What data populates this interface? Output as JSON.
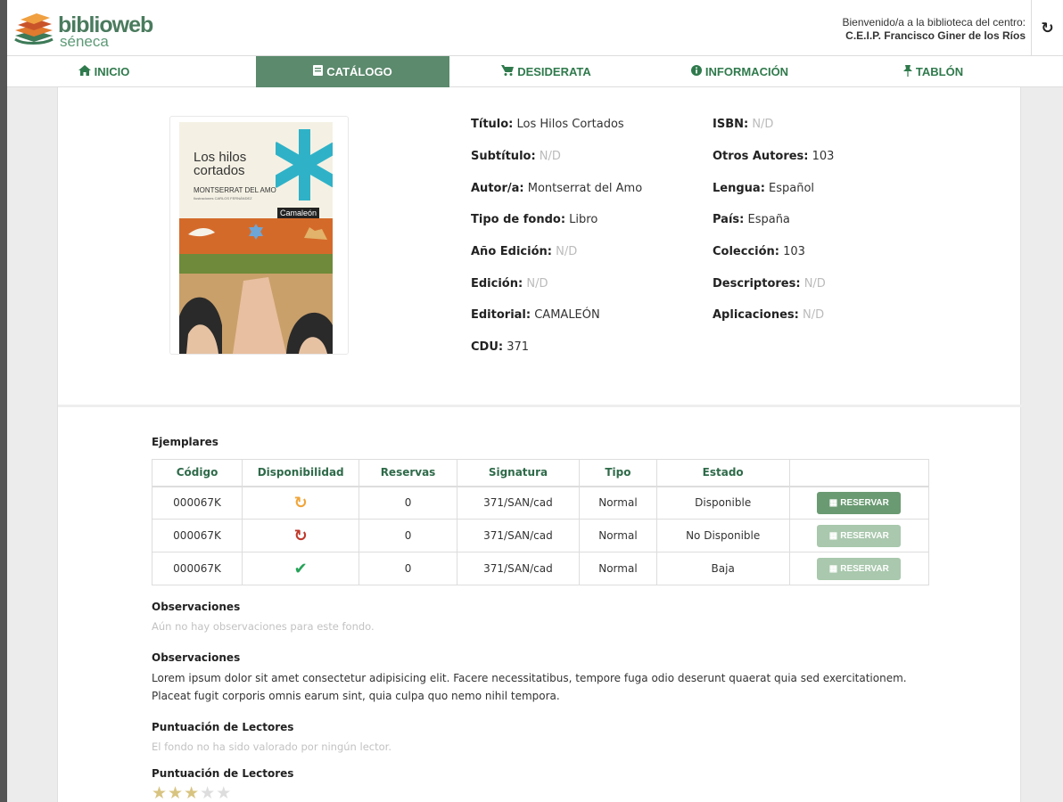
{
  "header": {
    "logo_main": "biblioweb",
    "logo_sub": "séneca",
    "welcome_line": "Bienvenido/a a la biblioteca del centro:",
    "school_name": "C.E.I.P. Francisco Giner de los Ríos",
    "refresh_icon": "refresh-icon"
  },
  "nav": {
    "items": [
      {
        "label": "INICIO",
        "icon": "home-icon",
        "active": false
      },
      {
        "label": "CATÁLOGO",
        "icon": "book-icon",
        "active": true
      },
      {
        "label": "DESIDERATA",
        "icon": "cart-icon",
        "active": false
      },
      {
        "label": "INFORMACIÓN",
        "icon": "info-icon",
        "active": false
      },
      {
        "label": "TABLÓN",
        "icon": "pin-icon",
        "active": false
      }
    ]
  },
  "cover": {
    "title": "Los hilos cortados",
    "author": "MONTSERRAT DEL AMO",
    "illustrator": "Ilustraciones CARLOS FERNÁNDEZ",
    "brand": "Camaleón"
  },
  "details": {
    "left": [
      {
        "label": "Título:",
        "value": "Los Hilos Cortados",
        "na": false
      },
      {
        "label": "Subtítulo:",
        "value": "N/D",
        "na": true
      },
      {
        "label": "Autor/a:",
        "value": "Montserrat del Amo",
        "na": false
      },
      {
        "label": "Tipo de fondo:",
        "value": "Libro",
        "na": false
      },
      {
        "label": "Año Edición:",
        "value": "N/D",
        "na": true
      },
      {
        "label": "Edición:",
        "value": "N/D",
        "na": true
      },
      {
        "label": "Editorial:",
        "value": "CAMALEÓN",
        "na": false
      },
      {
        "label": "CDU:",
        "value": "371",
        "na": false
      }
    ],
    "right": [
      {
        "label": "ISBN:",
        "value": "N/D",
        "na": true
      },
      {
        "label": "Otros Autores:",
        "value": "103",
        "na": false
      },
      {
        "label": "Lengua:",
        "value": "Español",
        "na": false
      },
      {
        "label": "País:",
        "value": "España",
        "na": false
      },
      {
        "label": "Colección:",
        "value": "103",
        "na": false
      },
      {
        "label": "Descriptores:",
        "value": "N/D",
        "na": true
      },
      {
        "label": "Aplicaciones:",
        "value": "N/D",
        "na": true
      }
    ]
  },
  "ejemplares": {
    "title": "Ejemplares",
    "columns": [
      "Código",
      "Disponibilidad",
      "Reservas",
      "Signatura",
      "Tipo",
      "Estado",
      ""
    ],
    "rows": [
      {
        "codigo": "000067K",
        "disponibilidad_icon": "refresh-orange-icon",
        "reservas": "0",
        "signatura": "371/SAN/cad",
        "tipo": "Normal",
        "estado": "Disponible",
        "button": "RESERVAR",
        "enabled": true
      },
      {
        "codigo": "000067K",
        "disponibilidad_icon": "clock-red-icon",
        "reservas": "0",
        "signatura": "371/SAN/cad",
        "tipo": "Normal",
        "estado": "No Disponible",
        "button": "RESERVAR",
        "enabled": false
      },
      {
        "codigo": "000067K",
        "disponibilidad_icon": "check-green-icon",
        "reservas": "0",
        "signatura": "371/SAN/cad",
        "tipo": "Normal",
        "estado": "Baja",
        "button": "RESERVAR",
        "enabled": false
      }
    ]
  },
  "observaciones_empty": {
    "title": "Observaciones",
    "text": "Aún no hay observaciones para este fondo."
  },
  "observaciones": {
    "title": "Observaciones",
    "text": "Lorem ipsum dolor sit amet consectetur adipisicing elit. Facere necessitatibus, tempore fuga odio deserunt quaerat quia sed exercitationem. Placeat fugit corporis omnis earum sint, quia culpa quo nemo nihil tempora."
  },
  "puntuacion_empty": {
    "title": "Puntuación de Lectores",
    "text": "El fondo no ha sido valorado por ningún lector."
  },
  "puntuacion": {
    "title": "Puntuación de Lectores",
    "rating": 3,
    "max": 5
  },
  "colors": {
    "accent": "#5b8a6c",
    "nav_text": "#2f7a4c",
    "na_text": "#bbbbbb",
    "star_on": "#d8c481"
  }
}
